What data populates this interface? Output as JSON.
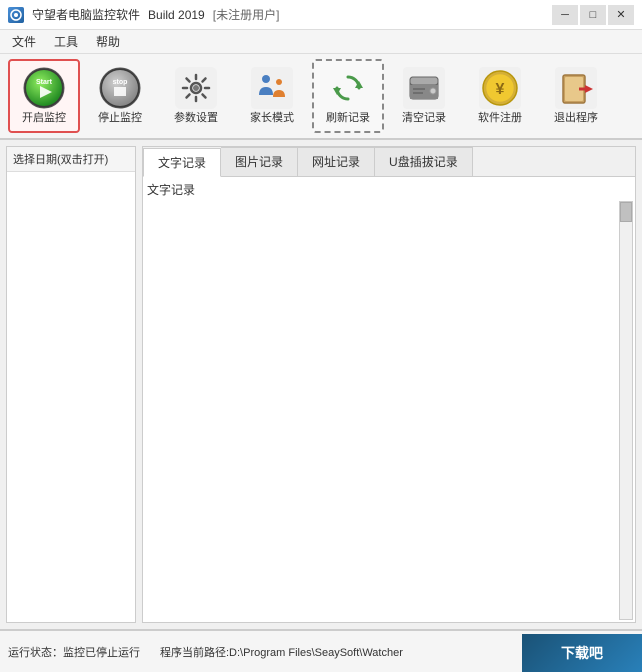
{
  "titleBar": {
    "appName": "守望者电脑监控软件",
    "build": "Build 2019",
    "userStatus": "[未注册用户]",
    "minBtn": "─",
    "maxBtn": "□",
    "closeBtn": "✕"
  },
  "menuBar": {
    "items": [
      "文件",
      "工具",
      "帮助"
    ]
  },
  "toolbar": {
    "buttons": [
      {
        "id": "start",
        "label": "开启监控",
        "active": true
      },
      {
        "id": "stop",
        "label": "停止监控",
        "active": false
      },
      {
        "id": "settings",
        "label": "参数设置",
        "active": false
      },
      {
        "id": "parent",
        "label": "家长模式",
        "active": false
      },
      {
        "id": "refresh",
        "label": "刷新记录",
        "active": false,
        "dashed": true
      },
      {
        "id": "clear",
        "label": "清空记录",
        "active": false
      },
      {
        "id": "register",
        "label": "软件注册",
        "active": false
      },
      {
        "id": "exit",
        "label": "退出程序",
        "active": false
      }
    ]
  },
  "leftPanel": {
    "title": "选择日期(双击打开)"
  },
  "tabs": [
    {
      "id": "text",
      "label": "文字记录",
      "active": true
    },
    {
      "id": "image",
      "label": "图片记录",
      "active": false
    },
    {
      "id": "url",
      "label": "网址记录",
      "active": false
    },
    {
      "id": "usb",
      "label": "U盘插拔记录",
      "active": false
    }
  ],
  "tabContent": {
    "title": "文字记录"
  },
  "statusBar": {
    "runStatus": "运行状态：监控已停止运行",
    "currentPath": "程序当前路径:D:\\Program Files\\SeaySoft\\Watcher"
  },
  "watermark": {
    "text": "下载吧"
  }
}
